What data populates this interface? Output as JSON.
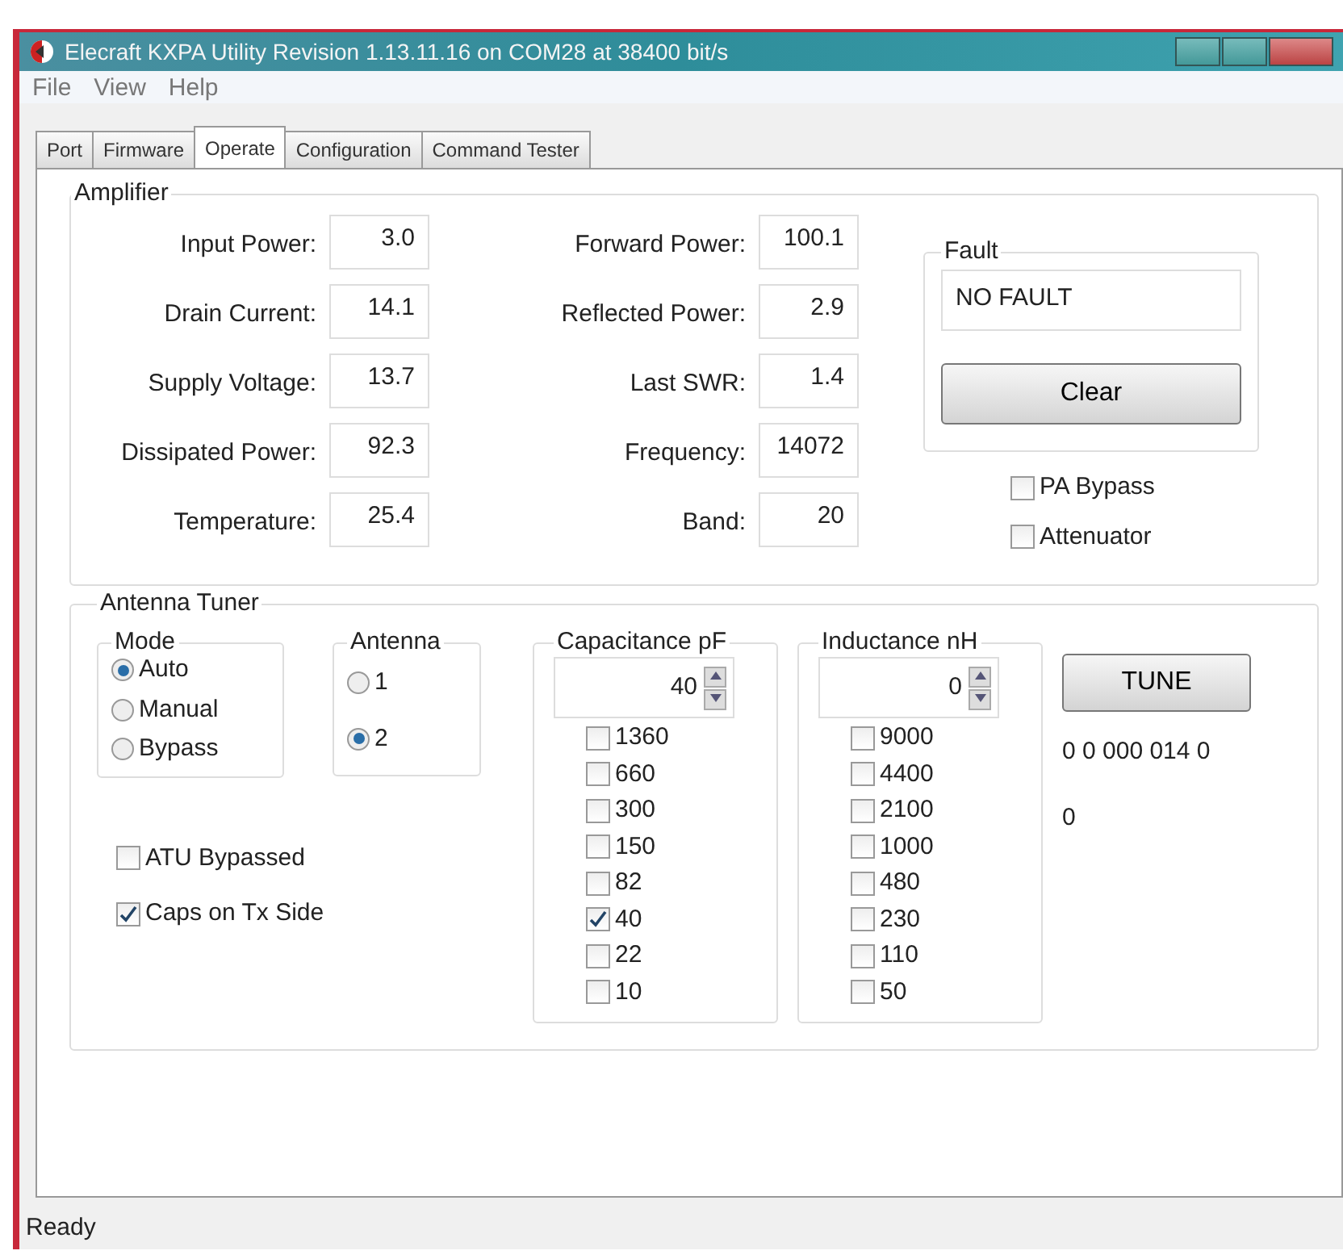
{
  "window": {
    "title": "Elecraft KXPA Utility Revision 1.13.11.16 on COM28 at 38400 bit/s"
  },
  "menu": [
    "File",
    "View",
    "Help"
  ],
  "tabs": [
    {
      "label": "Port",
      "selected": false
    },
    {
      "label": "Firmware",
      "selected": false
    },
    {
      "label": "Operate",
      "selected": true
    },
    {
      "label": "Configuration",
      "selected": false
    },
    {
      "label": "Command Tester",
      "selected": false
    }
  ],
  "amplifier": {
    "title": "Amplifier",
    "left": [
      {
        "label": "Input Power:",
        "value": "3.0"
      },
      {
        "label": "Drain Current:",
        "value": "14.1"
      },
      {
        "label": "Supply Voltage:",
        "value": "13.7"
      },
      {
        "label": "Dissipated Power:",
        "value": "92.3"
      },
      {
        "label": "Temperature:",
        "value": "25.4"
      }
    ],
    "right": [
      {
        "label": "Forward Power:",
        "value": "100.1"
      },
      {
        "label": "Reflected Power:",
        "value": "2.9"
      },
      {
        "label": "Last SWR:",
        "value": "1.4"
      },
      {
        "label": "Frequency:",
        "value": "14072"
      },
      {
        "label": "Band:",
        "value": "20"
      }
    ],
    "fault": {
      "title": "Fault",
      "value": "NO FAULT",
      "button": "Clear"
    },
    "options": [
      {
        "label": "PA Bypass",
        "checked": false
      },
      {
        "label": "Attenuator",
        "checked": false
      }
    ]
  },
  "antenna_tuner": {
    "title": "Antenna Tuner",
    "mode": {
      "title": "Mode",
      "options": [
        {
          "label": "Auto",
          "selected": true
        },
        {
          "label": "Manual",
          "selected": false
        },
        {
          "label": "Bypass",
          "selected": false
        }
      ]
    },
    "antenna": {
      "title": "Antenna",
      "options": [
        {
          "label": "1",
          "selected": false
        },
        {
          "label": "2",
          "selected": true
        }
      ]
    },
    "options": [
      {
        "label": "ATU Bypassed",
        "checked": false
      },
      {
        "label": "Caps on Tx Side",
        "checked": true
      }
    ],
    "capacitance": {
      "title": "Capacitance pF",
      "value": "40",
      "switches": [
        {
          "label": "1360",
          "checked": false
        },
        {
          "label": "660",
          "checked": false
        },
        {
          "label": "300",
          "checked": false
        },
        {
          "label": "150",
          "checked": false
        },
        {
          "label": "82",
          "checked": false
        },
        {
          "label": "40",
          "checked": true
        },
        {
          "label": "22",
          "checked": false
        },
        {
          "label": "10",
          "checked": false
        }
      ]
    },
    "inductance": {
      "title": "Inductance nH",
      "value": "0",
      "switches": [
        {
          "label": "9000",
          "checked": false
        },
        {
          "label": "4400",
          "checked": false
        },
        {
          "label": "2100",
          "checked": false
        },
        {
          "label": "1000",
          "checked": false
        },
        {
          "label": "480",
          "checked": false
        },
        {
          "label": "230",
          "checked": false
        },
        {
          "label": "110",
          "checked": false
        },
        {
          "label": "50",
          "checked": false
        }
      ]
    },
    "tune_button": "TUNE",
    "readouts": [
      "0 0 000 014 0",
      "0"
    ]
  },
  "status_bar": "Ready"
}
